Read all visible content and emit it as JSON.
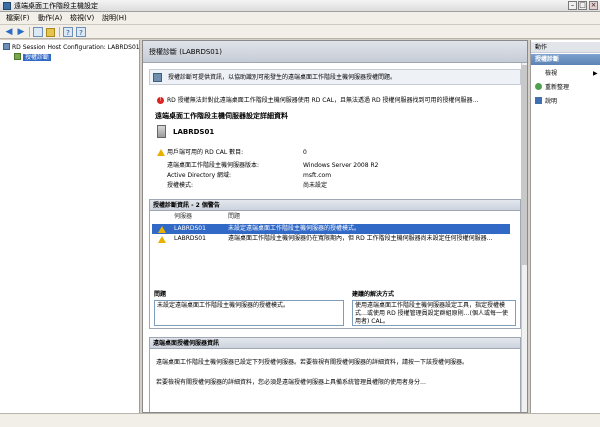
{
  "window": {
    "title": "遠端桌面工作階段主機設定",
    "min": "–",
    "max": "□",
    "close": "×"
  },
  "menu": [
    "檔案(F)",
    "動作(A)",
    "檢視(V)",
    "說明(H)"
  ],
  "toolbar": {
    "back": "◀",
    "forward": "▶",
    "help1": "?",
    "help2": "?"
  },
  "tree": {
    "root": "RD Session Host Configuration: LABRDS01",
    "child": "授權診斷"
  },
  "center": {
    "header": "授權診斷 (LABRDS01)",
    "banner": "授權診斷可提供資訊，以協助識別可能發生的遠端桌面工作階段主機伺服器授權問題。",
    "error_line": "RD 授權無法針對此遠端桌面工作階段主機伺服器使用 RD CAL，且無法透過 RD 授權伺服器找到可用的授權伺服器…",
    "server_section_title": "遠端桌面工作階段主機伺服器設定詳細資料",
    "server_name": "LABRDS01",
    "available_cal_label": "用戶端可用的 RD CAL 數目:",
    "available_cal_value": "0",
    "version_label": "遠端桌面工作階段主機伺服器版本:",
    "version_value": "Windows Server 2008 R2",
    "ad_domain_label": "Active Directory 網域:",
    "ad_domain_value": "msft.com",
    "licensing_mode_label": "授權模式:",
    "licensing_mode_value": "尚未設定",
    "diag_header": "授權診斷資訊 - 2 個警告",
    "diag_col_server": "伺服器",
    "diag_col_issue": "問題",
    "diag_rows": [
      {
        "server": "LABRDS01",
        "issue": "未設定遠端桌面工作階段主機伺服器的授權模式。"
      },
      {
        "server": "LABRDS01",
        "issue": "遠端桌面工作階段主機伺服器仍在寬限期內，但 RD 工作階段主機伺服器尚未設定任何授權伺服器…"
      }
    ],
    "problem_label": "問題",
    "problem_text": "未設定遠端桌面工作階段主機伺服器的授權模式。",
    "resolution_label": "建議的解決方式",
    "resolution_text": "使用遠端桌面工作階段主機伺服器設定工具，指定授權模式…或使用 RD 授權管理員設定群組原則…(個人或每一使用者) CAL。",
    "server_info_header": "遠端桌面授權伺服器資訊",
    "server_info_line1": "遠端桌面工作階段主機伺服器已設定下列授權伺服器。若要檢視有關授權伺服器的詳細資料，請按一下該授權伺服器。",
    "server_info_line2": "若要檢視有關授權伺服器的詳細資料，您必須是遠端授權伺服器上具備系統管理員權限的使用者身分…"
  },
  "actions": {
    "header": "動作",
    "subheader": "授權診斷",
    "items": [
      "檢視",
      "重新整理",
      "說明"
    ]
  },
  "colors": {
    "selection": "#3169c6",
    "header_blue": "#5b82b5",
    "warning": "#e8b100",
    "error": "#dd2222"
  }
}
